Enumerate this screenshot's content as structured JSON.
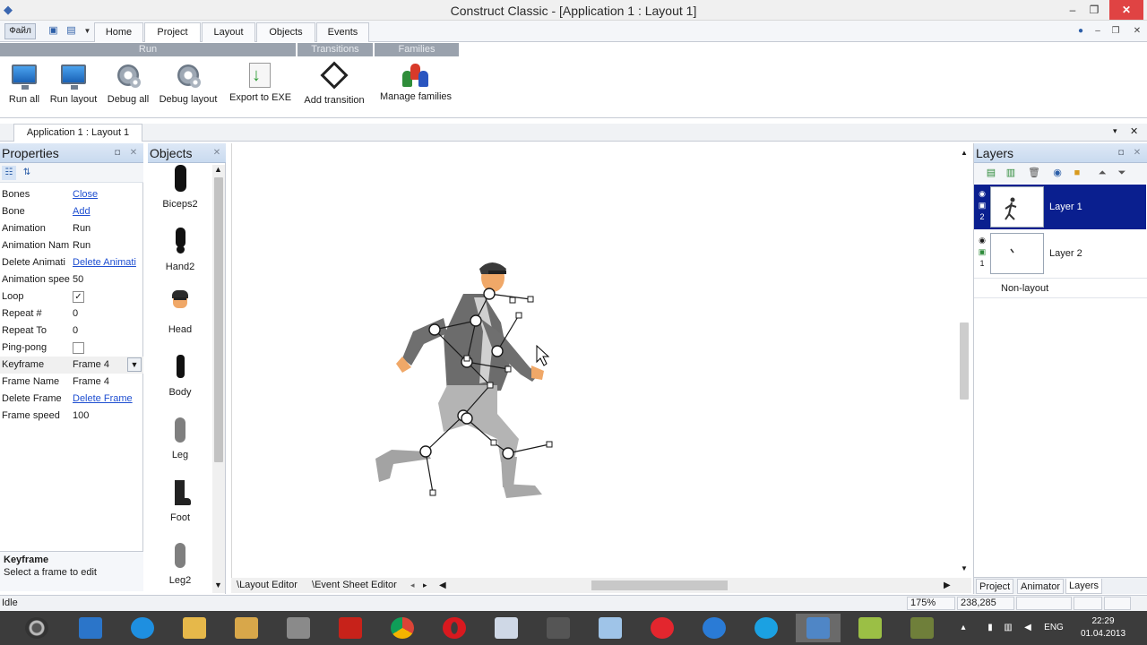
{
  "window": {
    "title": "Construct Classic - [Application 1 : Layout 1]",
    "min": "–",
    "restore": "❐",
    "close": "✕"
  },
  "ribbon": {
    "file_label": "Файл",
    "tabs": [
      "Home",
      "Project",
      "Layout",
      "Objects",
      "Events"
    ],
    "active_tab": "Project",
    "groups": [
      "Run",
      "Transitions",
      "Families"
    ],
    "buttons": [
      "Run all",
      "Run layout",
      "Debug all",
      "Debug layout",
      "Export to EXE",
      "Add transition",
      "Manage families"
    ]
  },
  "document_tab": "Application 1 : Layout 1",
  "properties": {
    "title": "Properties",
    "rows": [
      {
        "name": "Bones",
        "value": "Close"
      },
      {
        "name": "Bone",
        "value": "Add"
      },
      {
        "name": "Animation",
        "value": "Run"
      },
      {
        "name": "Animation Nam",
        "value": "Run"
      },
      {
        "name": "Delete Animati",
        "value": "Delete Animati"
      },
      {
        "name": "Animation spee",
        "value": "50"
      },
      {
        "name": "Loop",
        "value": "✓"
      },
      {
        "name": "Repeat #",
        "value": "0"
      },
      {
        "name": "Repeat To",
        "value": "0"
      },
      {
        "name": "Ping-pong",
        "value": ""
      },
      {
        "name": "Keyframe",
        "value": "Frame 4"
      },
      {
        "name": "Frame Name",
        "value": "Frame 4"
      },
      {
        "name": "Delete Frame",
        "value": "Delete Frame"
      },
      {
        "name": "Frame speed",
        "value": "100"
      }
    ],
    "help_title": "Keyframe",
    "help_desc": "Select a frame to edit"
  },
  "objects": {
    "title": "Objects",
    "items": [
      "Biceps2",
      "Hand2",
      "Head",
      "Body",
      "Leg",
      "Foot",
      "Leg2"
    ]
  },
  "editor_tabs": [
    "Layout Editor",
    "Event Sheet Editor"
  ],
  "layers": {
    "title": "Layers",
    "items": [
      {
        "name": "Layer 1",
        "number": "2"
      },
      {
        "name": "Layer 2",
        "number": "1"
      }
    ],
    "non_layout": "Non-layout",
    "bottom_tabs": [
      "Project",
      "Animator",
      "Layers"
    ]
  },
  "status": {
    "state": "Idle",
    "zoom": "175%",
    "coords": "238,285"
  },
  "taskbar": {
    "lang": "ENG",
    "time": "22:29",
    "date": "01.04.2013"
  },
  "colors": {
    "selected_layer": "#0a1f8f",
    "link": "#1f4fd1",
    "close_button": "#e04343",
    "ribbon_group": "#9aa2ad"
  }
}
